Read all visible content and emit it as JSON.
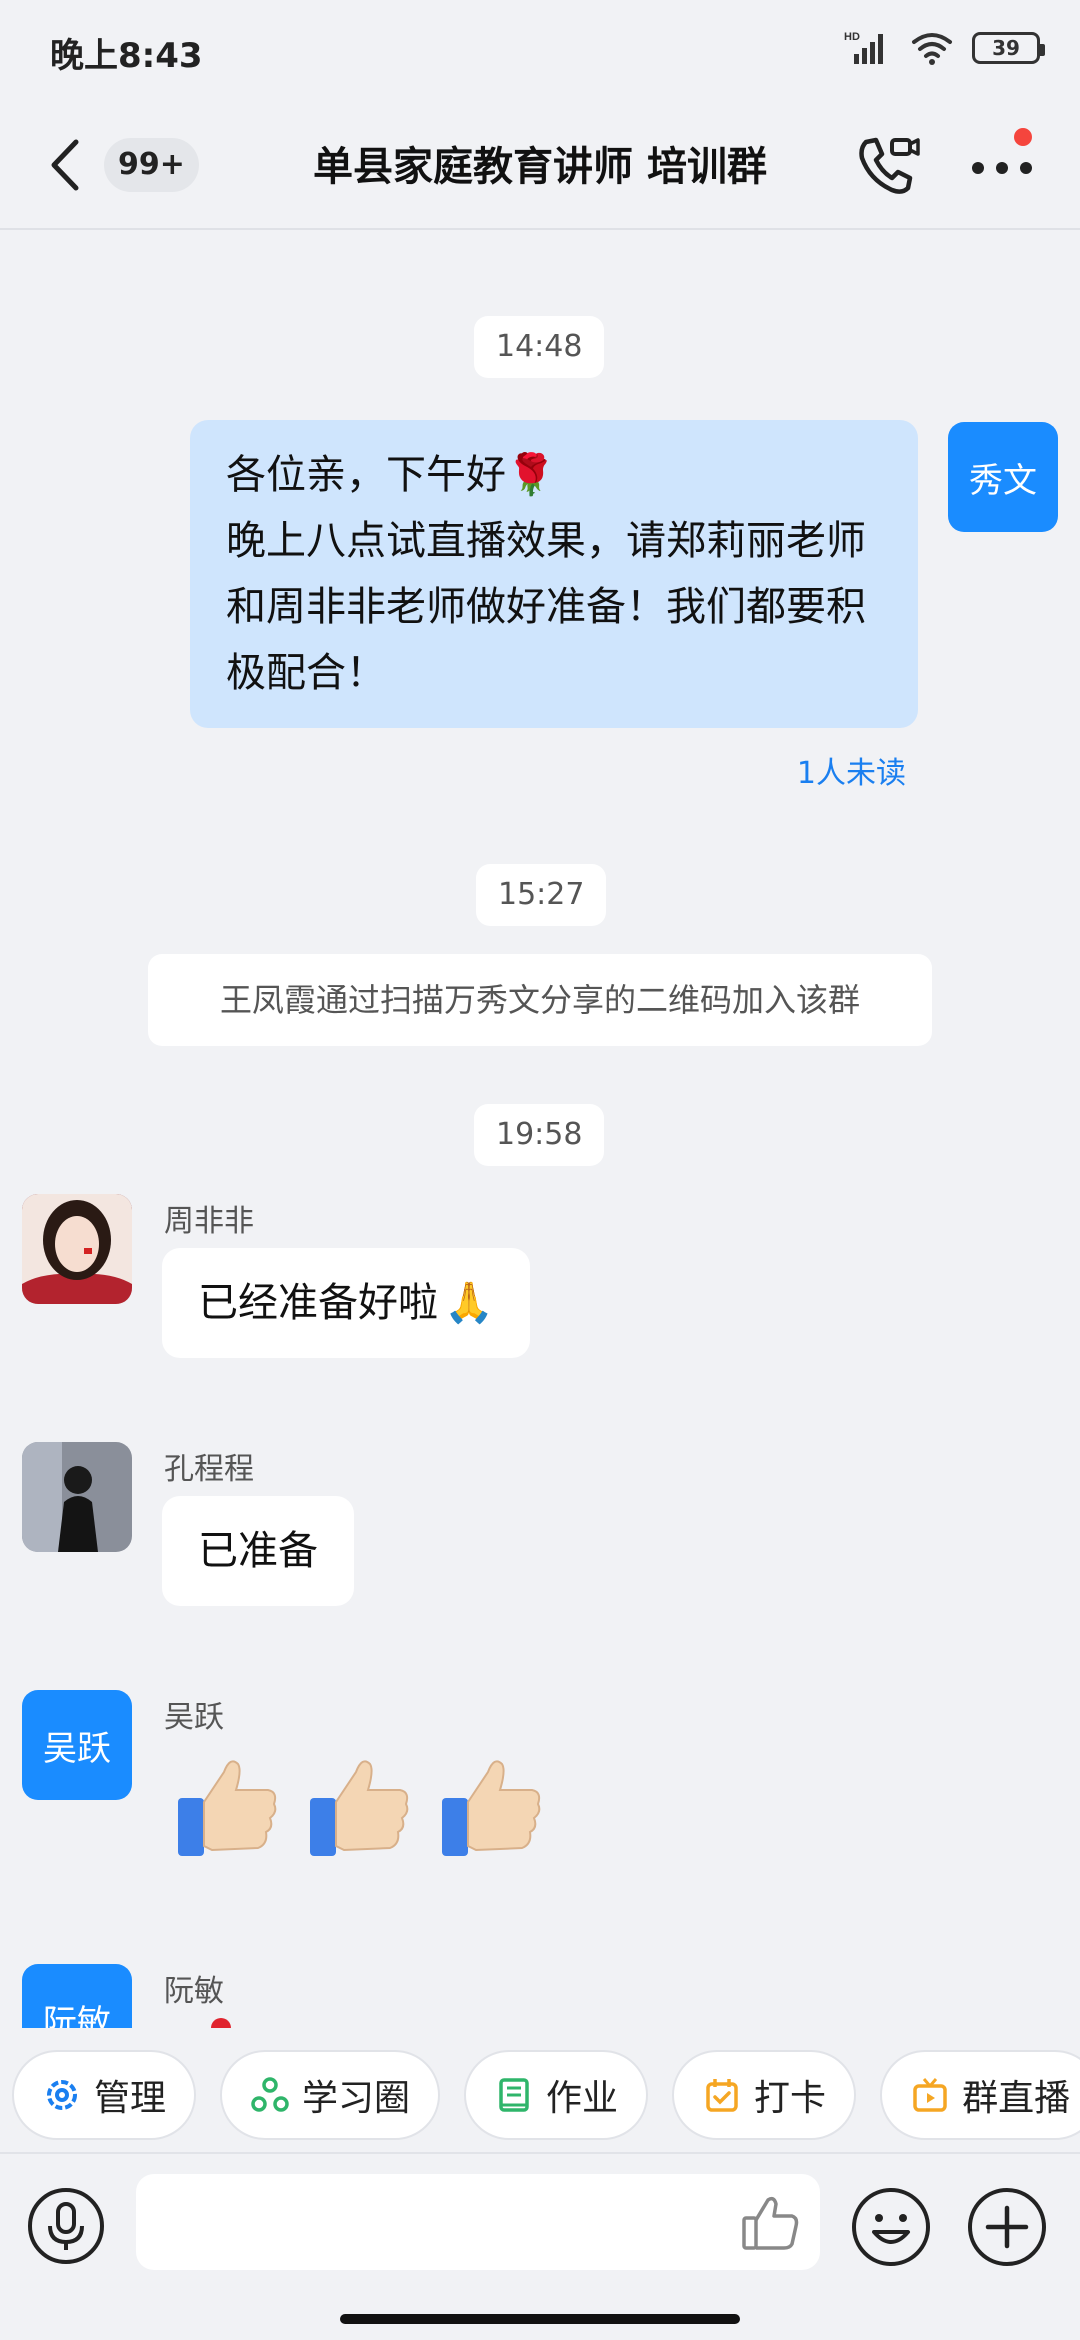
{
  "status": {
    "time": "晚上8:43",
    "battery": "39",
    "network": "HD"
  },
  "header": {
    "title": "单县家庭教育讲师 培训群",
    "unread_count": "99+"
  },
  "messages": {
    "time1": "14:48",
    "msg1": {
      "sender_avatar": "秀文",
      "line1": "各位亲，下午好",
      "line1_emoji": "🌹",
      "body": "晚上八点试直播效果，请郑莉丽老师和周非非老师做好准备！我们都要积极配合！",
      "read_status": "1人未读"
    },
    "time2": "15:27",
    "notice": "王凤霞通过扫描万秀文分享的二维码加入该群",
    "time3": "19:58",
    "msg2": {
      "sender": "周非非",
      "text": "已经准备好啦",
      "emoji": "🙏"
    },
    "msg3": {
      "sender": "孔程程",
      "text": "已准备"
    },
    "msg4": {
      "sender": "吴跃",
      "sender_avatar": "吴跃",
      "emoji": "👍"
    },
    "msg5": {
      "sender": "阮敏",
      "sender_avatar": "阮敏"
    }
  },
  "quick_actions": [
    {
      "label": "管理",
      "icon": "gear-icon",
      "color": "#1a7ff0"
    },
    {
      "label": "学习圈",
      "icon": "circle-nodes-icon",
      "color": "#2fb56a"
    },
    {
      "label": "作业",
      "icon": "book-icon",
      "color": "#2fb56a"
    },
    {
      "label": "打卡",
      "icon": "calendar-check-icon",
      "color": "#f5a623"
    },
    {
      "label": "群直播",
      "icon": "tv-icon",
      "color": "#f5a623"
    }
  ],
  "colors": {
    "accent": "#1a8cff",
    "outgoing_bubble": "#cfe5fd",
    "background": "#f1f2f5",
    "badge_red": "#f5453d"
  }
}
